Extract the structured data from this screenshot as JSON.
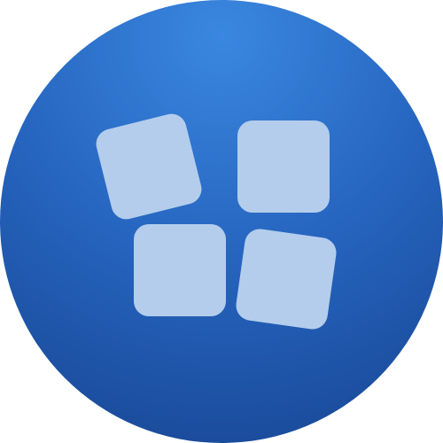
{
  "icon": {
    "name": "app-grid-icon",
    "tile_icon": "rounded-square-tile",
    "tile_count": 4,
    "colors": {
      "circle_highlight": "#3a87e0",
      "circle_mid": "#2563bd",
      "circle_edge": "#1a4a99",
      "tile_fill": "#b4cdec"
    }
  }
}
